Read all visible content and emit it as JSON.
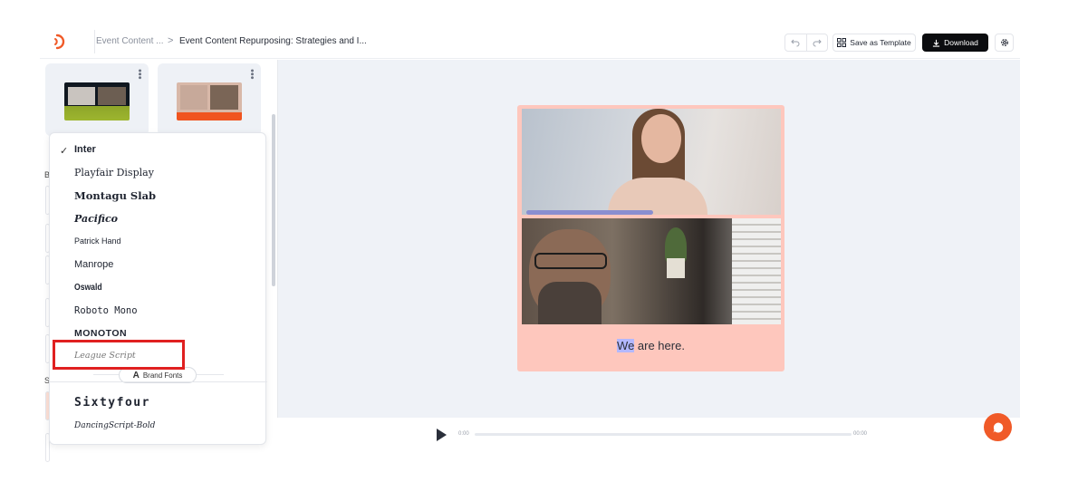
{
  "header": {
    "breadcrumb_root": "Event Content ...",
    "breadcrumb_separator": ">",
    "breadcrumb_current": "Event Content Repurposing: Strategies and I...",
    "save_template_label": "Save as Template",
    "download_label": "Download"
  },
  "font_menu": {
    "selected": "Inter",
    "fonts": [
      "Inter",
      "Playfair Display",
      "Montagu Slab",
      "Pacifico",
      "Patrick Hand",
      "Manrope",
      "Oswald",
      "Roboto Mono",
      "Monoton",
      "League Script"
    ],
    "brand_fonts_label": "Brand Fonts",
    "brand_fonts": [
      "Sixtyfour",
      "DancingScript-Bold"
    ]
  },
  "sidebar": {
    "partial_letters": [
      "B",
      "S"
    ]
  },
  "canvas": {
    "caption_highlight": "We",
    "caption_rest": " are here."
  },
  "player": {
    "current_time": "0:00",
    "total_time": "00:00"
  },
  "colors": {
    "brand_orange": "#f05a28",
    "clip_background": "#fec7bd",
    "download_bg": "#0b0c0f",
    "annotation_red": "#e02020"
  }
}
